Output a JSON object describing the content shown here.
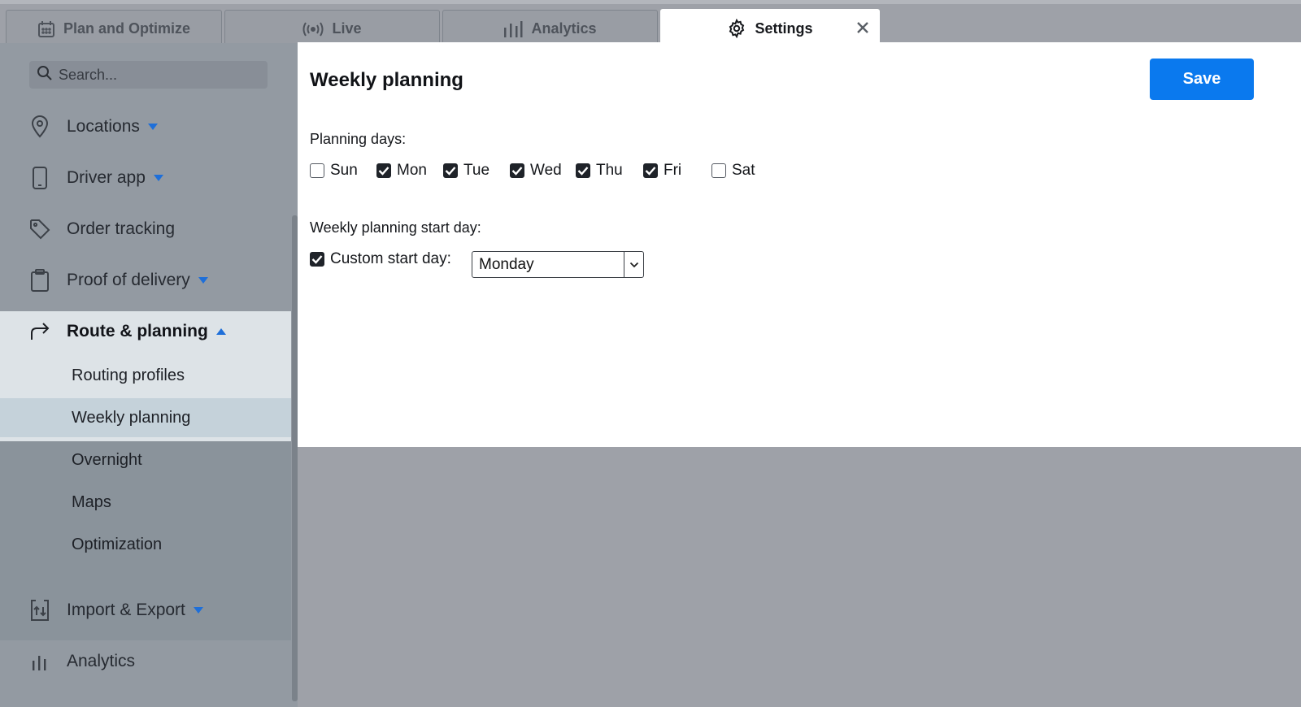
{
  "tabs": [
    {
      "label": "Plan and Optimize",
      "icon": "calendar-icon"
    },
    {
      "label": "Live",
      "icon": "broadcast-icon"
    },
    {
      "label": "Analytics",
      "icon": "bar-chart-icon"
    },
    {
      "label": "Settings",
      "icon": "gear-icon",
      "active": true
    }
  ],
  "sidebar": {
    "search_placeholder": "Search...",
    "items": [
      {
        "label": "Locations",
        "icon": "map-pin-icon",
        "expand": "down"
      },
      {
        "label": "Driver app",
        "icon": "phone-icon",
        "expand": "down"
      },
      {
        "label": "Order tracking",
        "icon": "tag-icon"
      },
      {
        "label": "Proof of delivery",
        "icon": "clipboard-icon",
        "expand": "down"
      },
      {
        "label": "Route & planning",
        "icon": "route-arrow-icon",
        "expand": "up"
      },
      {
        "label": "Import & Export",
        "icon": "import-export-icon",
        "expand": "down"
      },
      {
        "label": "Analytics",
        "icon": "bar-chart-icon"
      }
    ],
    "route_planning_subitems": [
      {
        "label": "Routing profiles"
      },
      {
        "label": "Weekly planning",
        "selected": true
      },
      {
        "label": "Overnight"
      },
      {
        "label": "Maps"
      },
      {
        "label": "Optimization"
      }
    ]
  },
  "panel": {
    "title": "Weekly planning",
    "save_label": "Save",
    "planning_days_label": "Planning days:",
    "days": [
      {
        "label": "Sun",
        "checked": false
      },
      {
        "label": "Mon",
        "checked": true
      },
      {
        "label": "Tue",
        "checked": true
      },
      {
        "label": "Wed",
        "checked": true
      },
      {
        "label": "Thu",
        "checked": true
      },
      {
        "label": "Fri",
        "checked": true
      },
      {
        "label": "Sat",
        "checked": false
      }
    ],
    "start_day_label": "Weekly planning start day:",
    "custom_start_label": "Custom start day:",
    "custom_start_checked": true,
    "custom_start_value": "Monday"
  },
  "colors": {
    "accent": "#0a79ee",
    "caret": "#1e6fd9",
    "sidebar_bg": "#939aa2",
    "selected_bg": "#c5d2da"
  }
}
